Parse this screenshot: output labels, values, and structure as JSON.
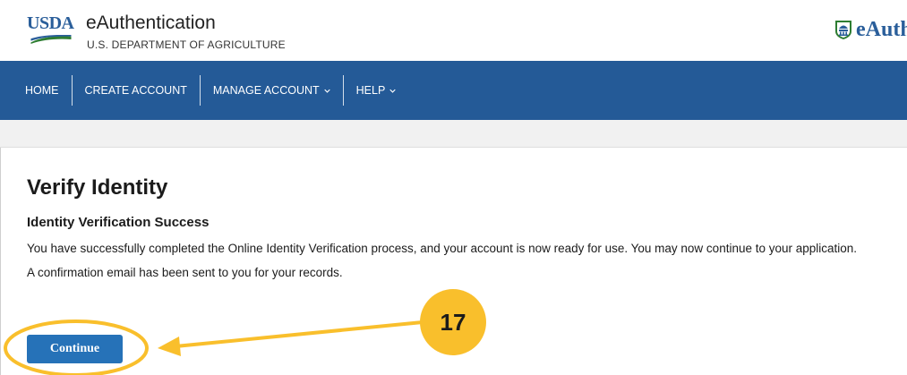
{
  "header": {
    "logo_text": "USDA",
    "brand_title": "eAuthentication",
    "brand_subtitle": "U.S. DEPARTMENT OF AGRICULTURE",
    "right_logo_text": "eAuth",
    "accent_color": "#2a5e9a"
  },
  "nav": {
    "background": "#245a97",
    "items": [
      {
        "label": "HOME"
      },
      {
        "label": "CREATE ACCOUNT"
      },
      {
        "label": "MANAGE ACCOUNT",
        "icon": "chevron-down-icon"
      },
      {
        "label": "HELP",
        "icon": "chevron-down-icon"
      }
    ]
  },
  "main": {
    "title": "Verify Identity",
    "subtitle": "Identity Verification Success",
    "message": "You have successfully completed the Online Identity Verification process, and your account is now ready for use. You may now continue to your application.",
    "confirmation": "A confirmation email has been sent to you for your records.",
    "continue_label": "Continue",
    "button_color": "#2672b8"
  },
  "annotation": {
    "step_number": "17",
    "highlight_color": "#f9bf2c"
  }
}
